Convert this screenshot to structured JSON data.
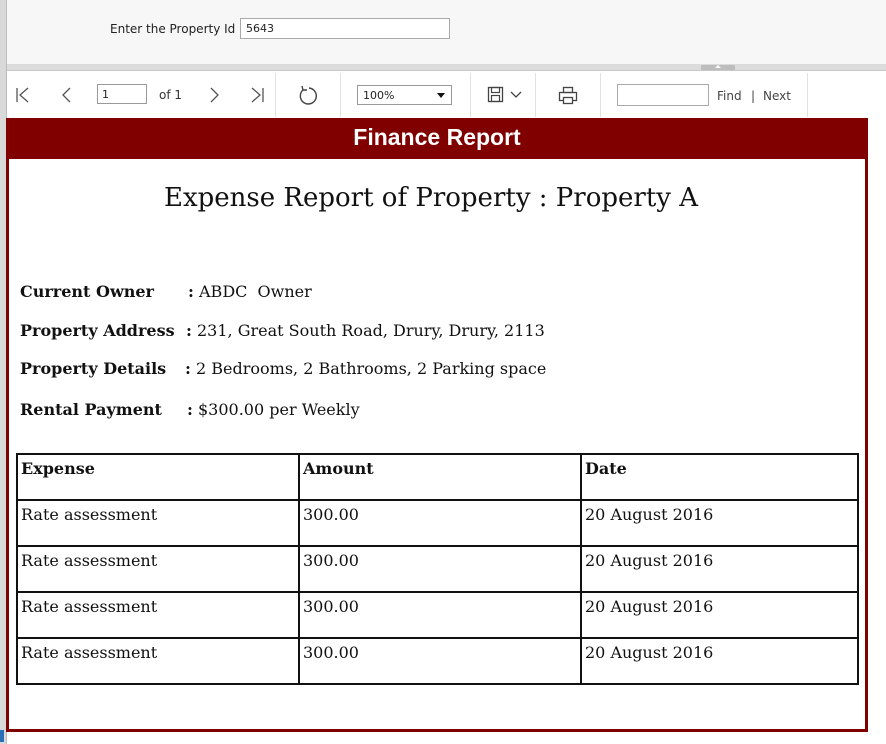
{
  "parameters": {
    "label": "Enter the Property Id",
    "property_id": "5643"
  },
  "toolbar": {
    "page_value": "1",
    "of_label": "of 1",
    "zoom": "100%",
    "find_label": "Find",
    "separator": "|",
    "next_label": "Next"
  },
  "report": {
    "banner": "Finance Report",
    "title": "Expense Report of Property : Property A",
    "fields": [
      {
        "label": "Current Owner",
        "value": "ABDC  Owner"
      },
      {
        "label": "Property Address",
        "value": "231, Great South Road, Drury, Drury, 2113"
      },
      {
        "label": "Property Details",
        "value": "2 Bedrooms, 2 Bathrooms, 2 Parking space"
      },
      {
        "label": "Rental Payment",
        "value": "$300.00 per Weekly"
      }
    ],
    "table": {
      "headers": [
        "Expense",
        "Amount",
        "Date"
      ],
      "rows": [
        [
          "Rate assessment",
          "300.00",
          "20 August 2016"
        ],
        [
          "Rate assessment",
          "300.00",
          "20 August 2016"
        ],
        [
          "Rate assessment",
          "300.00",
          "20 August 2016"
        ],
        [
          "Rate assessment",
          "300.00",
          "20 August 2016"
        ]
      ]
    }
  },
  "colors": {
    "banner": "#800000",
    "frame": "#800000"
  }
}
